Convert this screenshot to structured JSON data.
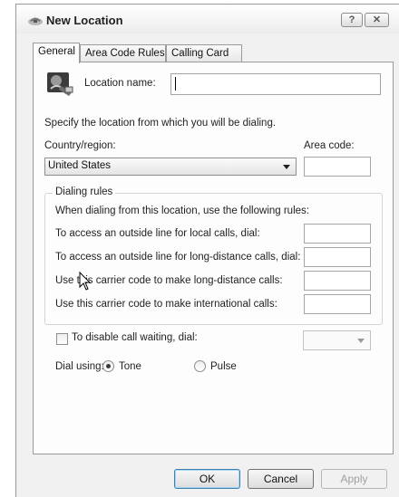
{
  "window": {
    "title": "New Location",
    "help_glyph": "?",
    "close_glyph": "✕"
  },
  "tabs": [
    {
      "label": "General",
      "selected": true
    },
    {
      "label": "Area Code Rules",
      "selected": false
    },
    {
      "label": "Calling Card",
      "selected": false
    }
  ],
  "general": {
    "location_name_label": "Location name:",
    "location_name_value": "",
    "specify_text": "Specify the location from which you will be dialing.",
    "country_label": "Country/region:",
    "country_value": "United States",
    "area_code_label": "Area code:",
    "area_code_value": ""
  },
  "dialing_rules": {
    "title": "Dialing rules",
    "intro": "When dialing from this location, use the following rules:",
    "rows": [
      {
        "label": "To access an outside line for local calls, dial:",
        "value": ""
      },
      {
        "label": "To access an outside line for long-distance calls, dial:",
        "value": ""
      },
      {
        "label": "Use this carrier code to make long-distance calls:",
        "value": ""
      },
      {
        "label": "Use this carrier code to make international calls:",
        "value": ""
      }
    ]
  },
  "call_waiting": {
    "label": "To disable call waiting, dial:",
    "checked": false,
    "value": ""
  },
  "dial_using": {
    "label": "Dial using:",
    "options": [
      "Tone",
      "Pulse"
    ],
    "selected": "Tone"
  },
  "buttons": {
    "ok": "OK",
    "cancel": "Cancel",
    "apply": "Apply"
  }
}
